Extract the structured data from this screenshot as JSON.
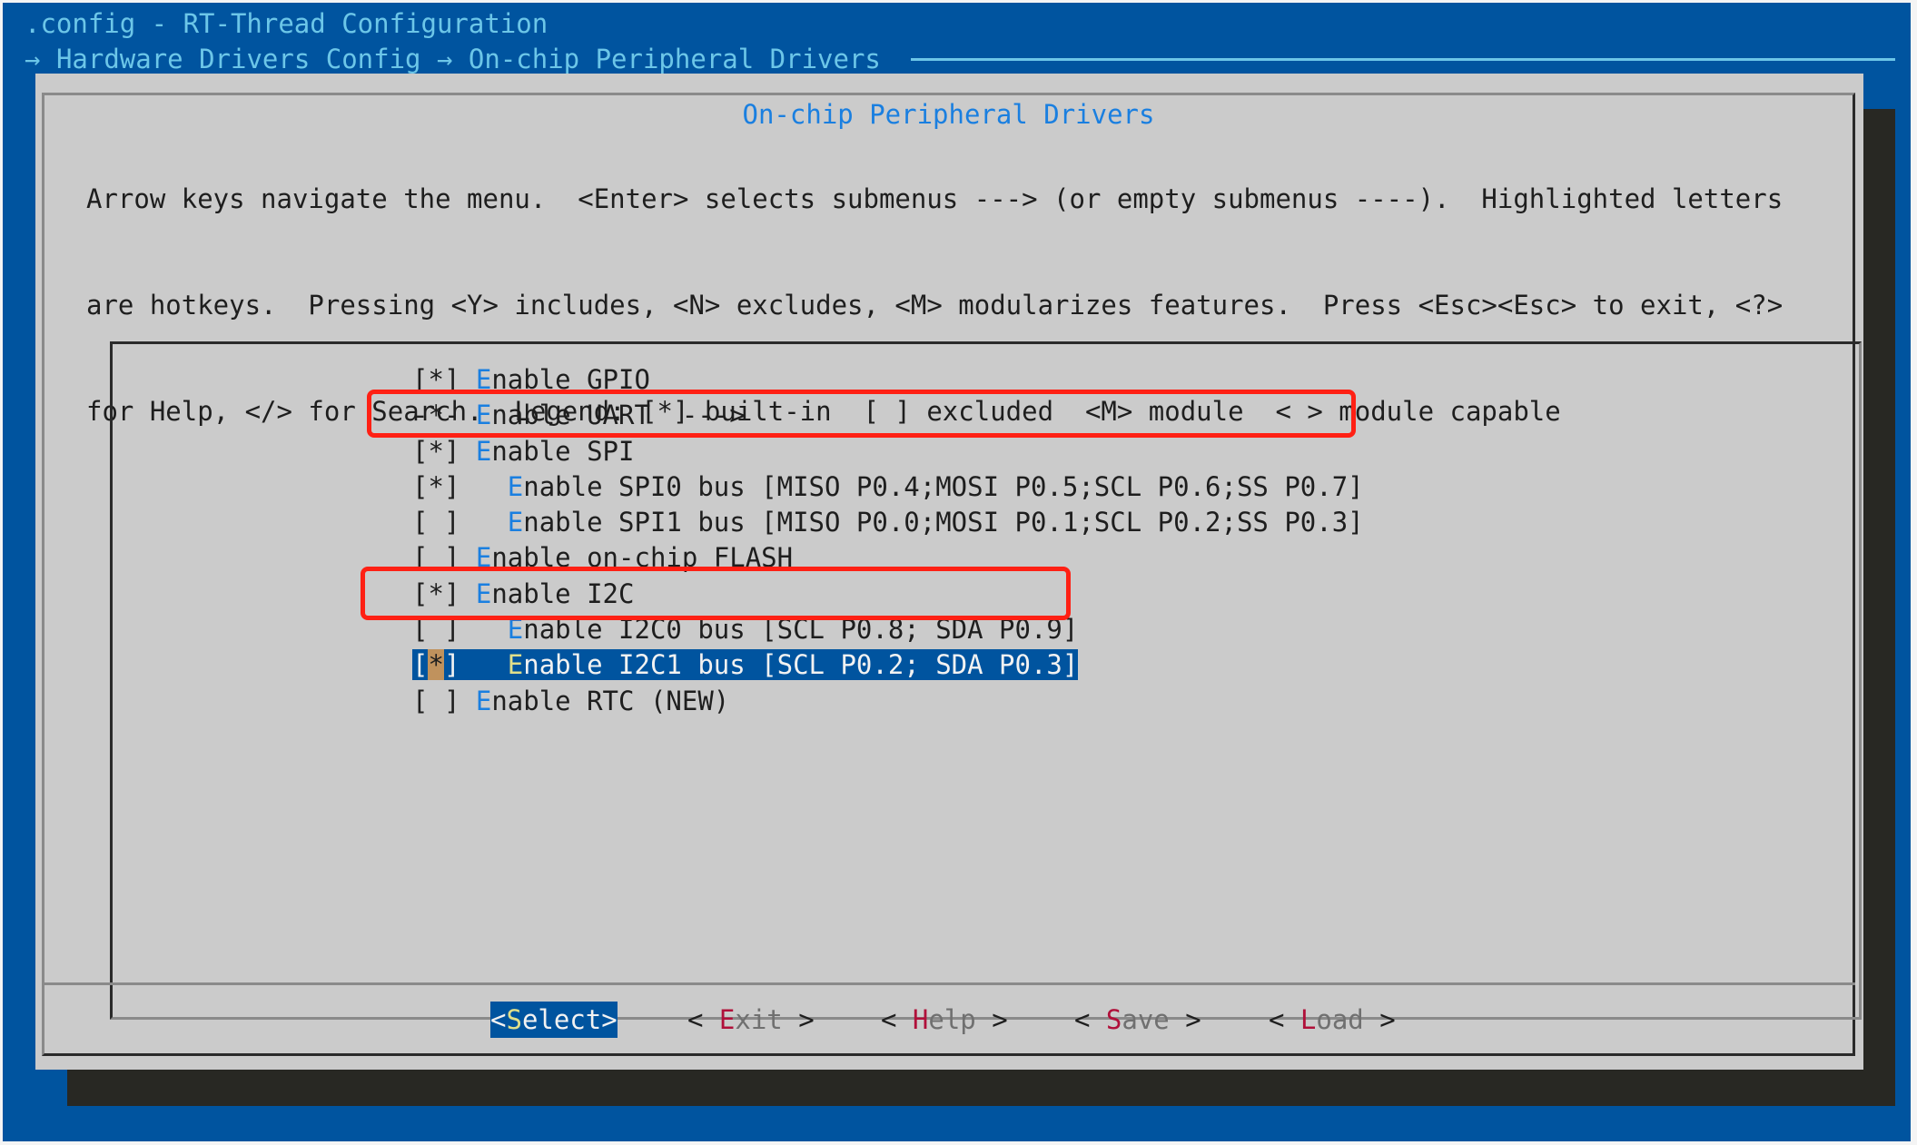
{
  "window": {
    "title": ".config - RT-Thread Configuration",
    "breadcrumb": [
      "Hardware Drivers Config",
      "On-chip Peripheral Drivers"
    ],
    "breadcrumb_separator": "→"
  },
  "dialog": {
    "title": "On-chip Peripheral Drivers",
    "help_lines": [
      "Arrow keys navigate the menu.  <Enter> selects submenus ---> (or empty submenus ----).  Highlighted letters",
      "are hotkeys.  Pressing <Y> includes, <N> excludes, <M> modularizes features.  Press <Esc><Esc> to exit, <?>",
      "for Help, </> for Search.  Legend: [*] built-in  [ ] excluded  <M> module  < > module capable"
    ]
  },
  "menu": {
    "items": [
      {
        "state_open": "[",
        "state_mark": "*",
        "state_close": "]",
        "indent": " ",
        "hotkey": "E",
        "label": "nable GPIO",
        "suffix": "",
        "selected": false,
        "annotated": false
      },
      {
        "state_open": "-",
        "state_mark": "*",
        "state_close": "-",
        "indent": " ",
        "hotkey": "E",
        "label": "nable UART",
        "suffix": "  --->",
        "selected": false,
        "annotated": false
      },
      {
        "state_open": "[",
        "state_mark": "*",
        "state_close": "]",
        "indent": " ",
        "hotkey": "E",
        "label": "nable SPI",
        "suffix": "",
        "selected": false,
        "annotated": false
      },
      {
        "state_open": "[",
        "state_mark": "*",
        "state_close": "]",
        "indent": "   ",
        "hotkey": "E",
        "label": "nable SPI0 bus [MISO P0.4;MOSI P0.5;SCL P0.6;SS P0.7]",
        "suffix": "",
        "selected": false,
        "annotated": true
      },
      {
        "state_open": "[",
        "state_mark": " ",
        "state_close": "]",
        "indent": "   ",
        "hotkey": "E",
        "label": "nable SPI1 bus [MISO P0.0;MOSI P0.1;SCL P0.2;SS P0.3]",
        "suffix": "",
        "selected": false,
        "annotated": false
      },
      {
        "state_open": "[",
        "state_mark": " ",
        "state_close": "]",
        "indent": " ",
        "hotkey": "E",
        "label": "nable on-chip FLASH",
        "suffix": "",
        "selected": false,
        "annotated": false
      },
      {
        "state_open": "[",
        "state_mark": "*",
        "state_close": "]",
        "indent": " ",
        "hotkey": "E",
        "label": "nable I2C",
        "suffix": "",
        "selected": false,
        "annotated": false
      },
      {
        "state_open": "[",
        "state_mark": " ",
        "state_close": "]",
        "indent": "   ",
        "hotkey": "E",
        "label": "nable I2C0 bus [SCL P0.8; SDA P0.9]",
        "suffix": "",
        "selected": false,
        "annotated": false
      },
      {
        "state_open": "[",
        "state_mark": "*",
        "state_close": "]",
        "indent": "   ",
        "hotkey": "E",
        "label": "nable I2C1 bus [SCL P0.2; SDA P0.3]",
        "suffix": "",
        "selected": true,
        "annotated": true
      },
      {
        "state_open": "[",
        "state_mark": " ",
        "state_close": "]",
        "indent": " ",
        "hotkey": "E",
        "label": "nable RTC (NEW)",
        "suffix": "",
        "selected": false,
        "annotated": false
      }
    ]
  },
  "buttons": [
    {
      "open": "<",
      "hotkey": "S",
      "label": "elect",
      "close": ">",
      "active": true
    },
    {
      "open": "< ",
      "hotkey": "E",
      "label": "xit",
      "close": " >",
      "active": false
    },
    {
      "open": "< ",
      "hotkey": "H",
      "label": "elp",
      "close": " >",
      "active": false
    },
    {
      "open": "< ",
      "hotkey": "S",
      "label": "ave",
      "close": " >",
      "active": false
    },
    {
      "open": "< ",
      "hotkey": "L",
      "label": "oad",
      "close": " >",
      "active": false
    }
  ],
  "colors": {
    "terminal_bg": "#00549f",
    "dialog_bg": "#cbcbcb",
    "title_text": "#6cc6e8",
    "dialog_title": "#1a7fe0",
    "hotkey": "#1a7fe0",
    "button_hotkey": "#b0103a",
    "selection_bg": "#00549f",
    "cursor_bg": "#c0925d",
    "annotation": "#ff2014"
  }
}
